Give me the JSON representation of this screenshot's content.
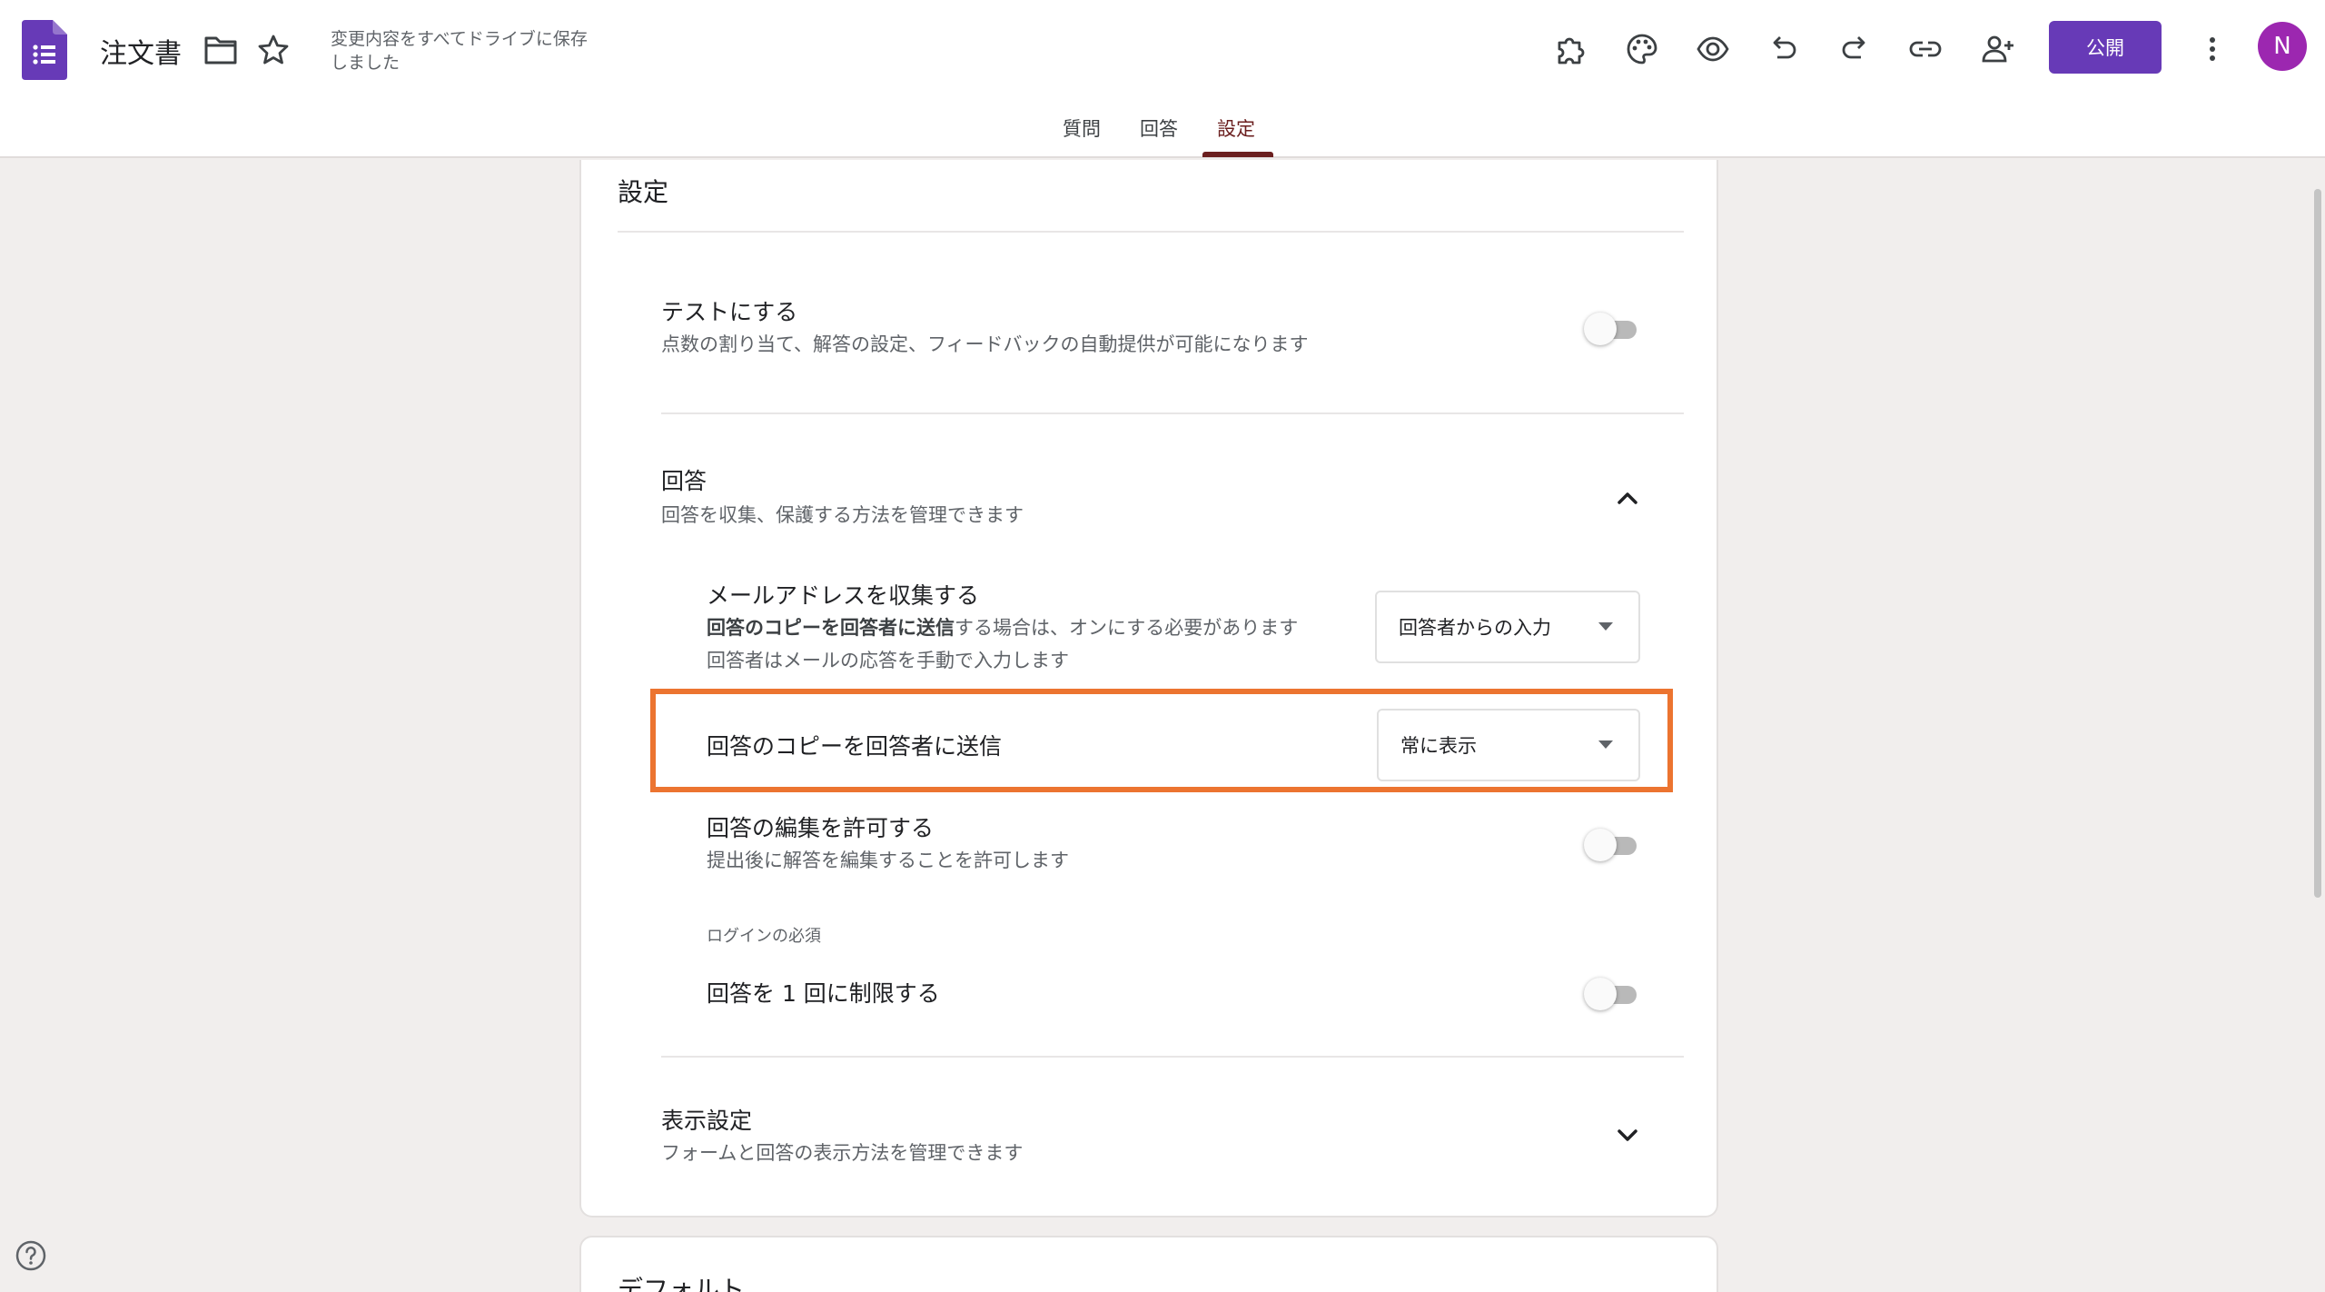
{
  "header": {
    "doc_title": "注文書",
    "save_status": "変更内容をすべてドライブに保存しました",
    "publish_label": "公開",
    "avatar_initial": "N",
    "tools": [
      "addon-icon",
      "palette-icon",
      "preview-eye-icon",
      "undo-icon",
      "redo-icon",
      "link-icon",
      "add-collaborator-icon",
      "more-vert-icon"
    ]
  },
  "tabs": [
    {
      "label": "質問",
      "active": false
    },
    {
      "label": "回答",
      "active": false
    },
    {
      "label": "設定",
      "active": true
    }
  ],
  "settings": {
    "heading": "設定",
    "quiz": {
      "title": "テストにする",
      "desc": "点数の割り当て、解答の設定、フィードバックの自動提供が可能になります",
      "enabled": false
    },
    "responses": {
      "title": "回答",
      "desc": "回答を収集、保護する方法を管理できます",
      "expanded": true,
      "collect_email": {
        "title": "メールアドレスを収集する",
        "desc_bold": "回答のコピーを回答者に送信",
        "desc_rest": "する場合は、オンにする必要があります",
        "desc2": "回答者はメールの応答を手動で入力します",
        "value": "回答者からの入力"
      },
      "send_copy": {
        "title": "回答のコピーを回答者に送信",
        "value": "常に表示"
      },
      "allow_edit": {
        "title": "回答の編集を許可する",
        "desc": "提出後に解答を編集することを許可します",
        "enabled": false
      },
      "login_required_label": "ログインの必須",
      "limit_one": {
        "title": "回答を 1 回に制限する",
        "enabled": false
      }
    },
    "presentation": {
      "title": "表示設定",
      "desc": "フォームと回答の表示方法を管理できます",
      "expanded": false
    }
  },
  "next_card_title": "デフォルト",
  "colors": {
    "accent": "#673ab7",
    "active_tab": "#6b1f1f",
    "highlight": "#ec7430",
    "avatar": "#9c27b0"
  }
}
